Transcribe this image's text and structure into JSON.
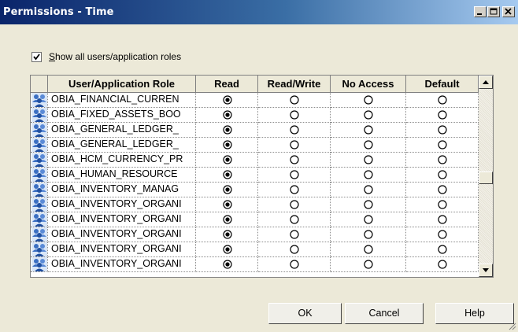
{
  "window": {
    "title": "Permissions - Time",
    "buttons": [
      "minimize-icon",
      "maximize-icon",
      "close-icon"
    ]
  },
  "show_all": {
    "checked": true,
    "label_underlined": "S",
    "label_rest": "how all users/application roles"
  },
  "grid": {
    "columns": [
      "User/Application Role",
      "Read",
      "Read/Write",
      "No Access",
      "Default"
    ],
    "rows": [
      {
        "role": "OBIA_FINANCIAL_CURREN",
        "selected": "Read"
      },
      {
        "role": "OBIA_FIXED_ASSETS_BOO",
        "selected": "Read"
      },
      {
        "role": "OBIA_GENERAL_LEDGER_",
        "selected": "Read"
      },
      {
        "role": "OBIA_GENERAL_LEDGER_",
        "selected": "Read"
      },
      {
        "role": "OBIA_HCM_CURRENCY_PR",
        "selected": "Read"
      },
      {
        "role": "OBIA_HUMAN_RESOURCE",
        "selected": "Read"
      },
      {
        "role": "OBIA_INVENTORY_MANAG",
        "selected": "Read"
      },
      {
        "role": "OBIA_INVENTORY_ORGANI",
        "selected": "Read"
      },
      {
        "role": "OBIA_INVENTORY_ORGANI",
        "selected": "Read"
      },
      {
        "role": "OBIA_INVENTORY_ORGANI",
        "selected": "Read"
      },
      {
        "role": "OBIA_INVENTORY_ORGANI",
        "selected": "Read"
      },
      {
        "role": "OBIA_INVENTORY_ORGANI",
        "selected": "Read"
      }
    ],
    "scrollbar_icons": [
      "scroll-up-icon",
      "scroll-down-icon"
    ]
  },
  "buttons": {
    "ok": "OK",
    "cancel": "Cancel",
    "help": "Help"
  },
  "colors": {
    "title_gradient_start": "#0a246a",
    "title_gradient_end": "#a6caf0",
    "dialog_bg": "#ece9d8"
  }
}
